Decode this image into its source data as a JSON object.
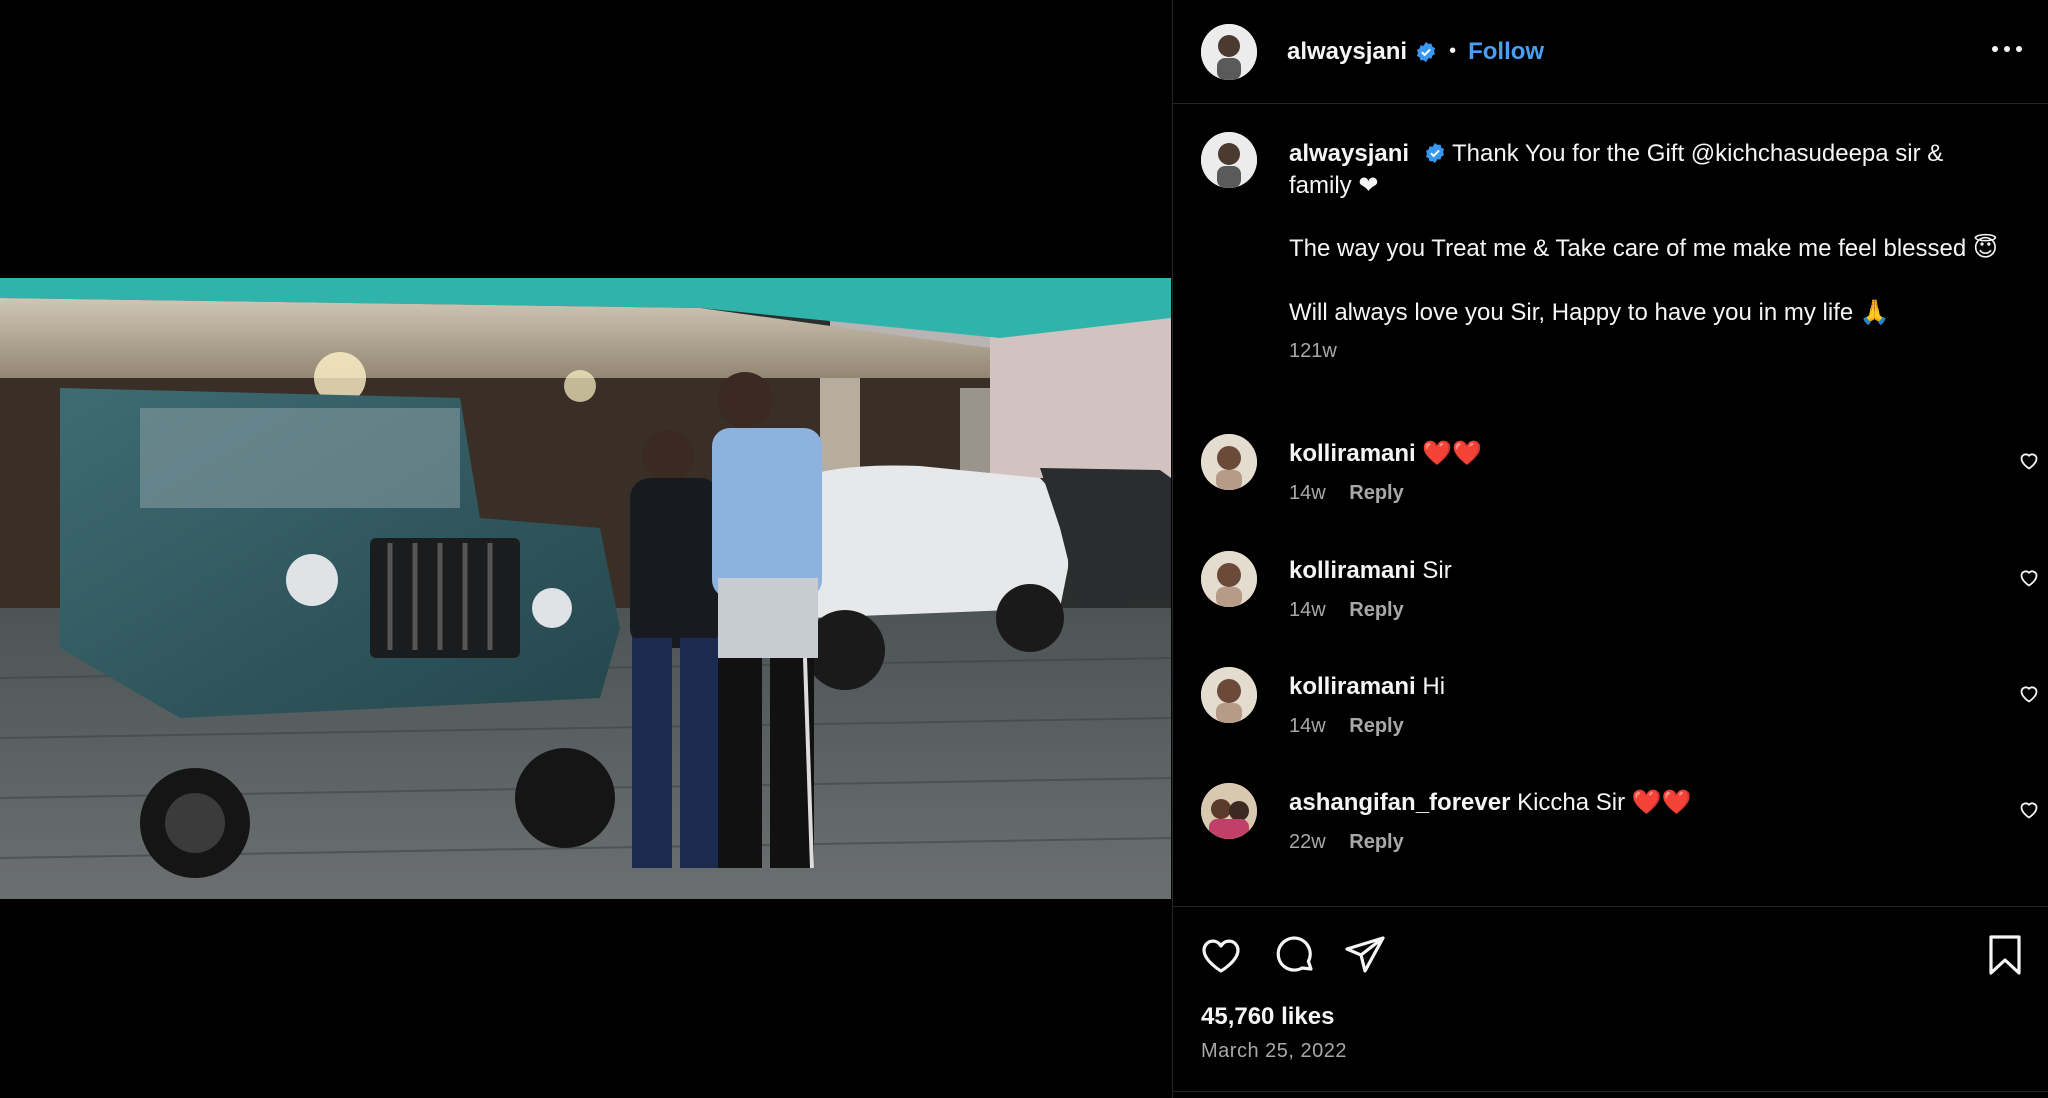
{
  "post": {
    "author": "alwaysjani",
    "follow_label": "Follow",
    "separator": "•"
  },
  "caption": {
    "username": "alwaysjani",
    "line1": "Thank You for the Gift @kichchasudeepa sir & family ❤",
    "line2": "The way you Treat me & Take care of me make me feel blessed 😇",
    "line3": "Will always love you Sir, Happy to have you in my life 🙏",
    "time": "121w"
  },
  "comments": [
    {
      "username": "kolliramani",
      "text": "❤️❤️",
      "time": "14w",
      "reply": "Reply"
    },
    {
      "username": "kolliramani",
      "text": "Sir",
      "time": "14w",
      "reply": "Reply"
    },
    {
      "username": "kolliramani",
      "text": "Hi",
      "time": "14w",
      "reply": "Reply"
    },
    {
      "username": "ashangifan_forever",
      "text": "Kiccha Sir ❤️❤️",
      "time": "22w",
      "reply": "Reply"
    }
  ],
  "footer": {
    "likes": "45,760 likes",
    "date": "March 25, 2022"
  },
  "icons": {
    "verified": "verified-badge-icon",
    "more": "more-options-icon",
    "like": "heart-icon",
    "comment": "comment-icon",
    "share": "share-icon",
    "save": "bookmark-icon"
  },
  "colors": {
    "background": "#000000",
    "accent": "#4a9ff5",
    "muted": "#a8a8a8",
    "divider": "#262626"
  }
}
